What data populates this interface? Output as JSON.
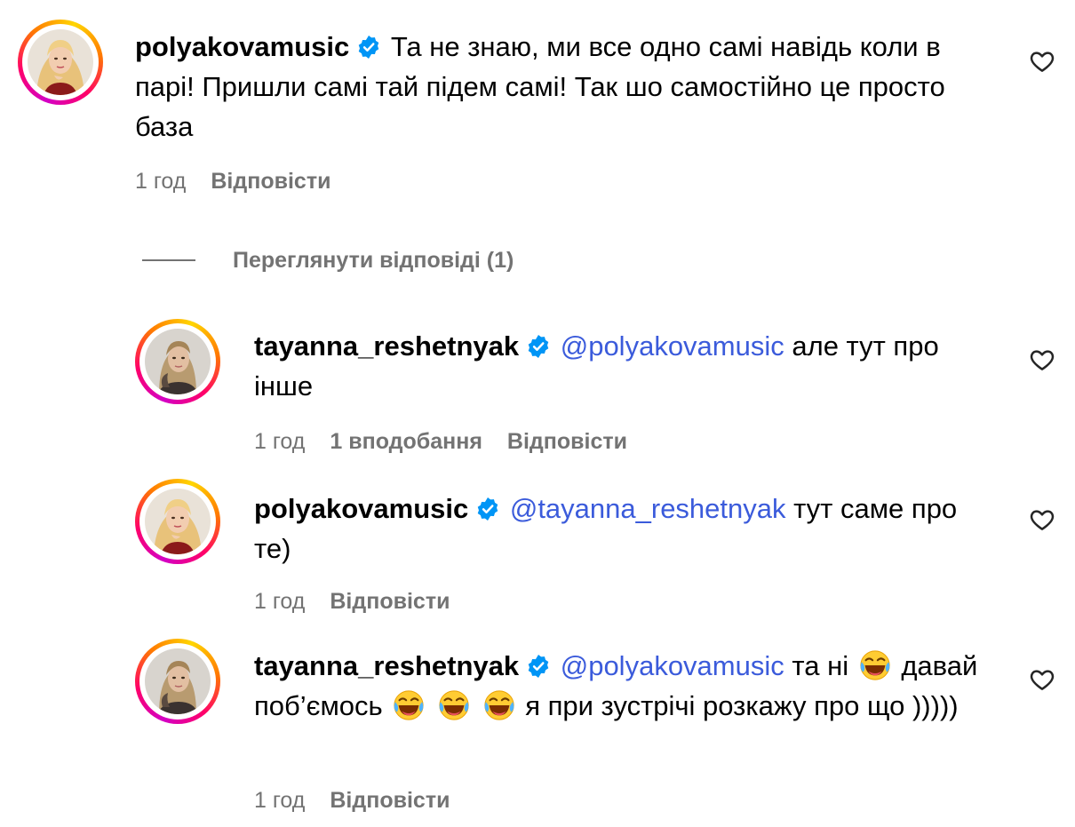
{
  "comments": [
    {
      "username": "polyakovamusic",
      "mention": "",
      "text": "Та не знаю, ми все одно самі навідь коли в парі! Пришли самі тай підем самі! Так шо самостійно це просто база",
      "meta": {
        "time": "1 год",
        "likes": "",
        "reply": "Відповісти"
      }
    },
    {
      "username": "tayanna_reshetnyak",
      "mention": "@polyakovamusic",
      "text": "але тут про інше",
      "meta": {
        "time": "1 год",
        "likes": "1 вподобання",
        "reply": "Відповісти"
      }
    },
    {
      "username": "polyakovamusic",
      "mention": "@tayanna_reshetnyak",
      "text": "тут саме про те)",
      "meta": {
        "time": "1 год",
        "likes": "",
        "reply": "Відповісти"
      }
    },
    {
      "username": "tayanna_reshetnyak",
      "mention": "@polyakovamusic",
      "text_part1": "та ні",
      "text_part2": "давай поб’ємось",
      "text_part3": "я при зустрічі розкажу про що )))))",
      "emoji": "face-with-tears-of-joy",
      "meta": {
        "time": "1 год",
        "likes": "",
        "reply": "Відповісти"
      }
    }
  ],
  "view_replies": {
    "label": "Переглянути відповіді (1)"
  },
  "icons": {
    "like": "heart-outline-icon",
    "verified": "verified-badge-icon"
  },
  "colors": {
    "mention": "#3b5bdb",
    "meta": "#737373",
    "verified": "#0095f6"
  }
}
